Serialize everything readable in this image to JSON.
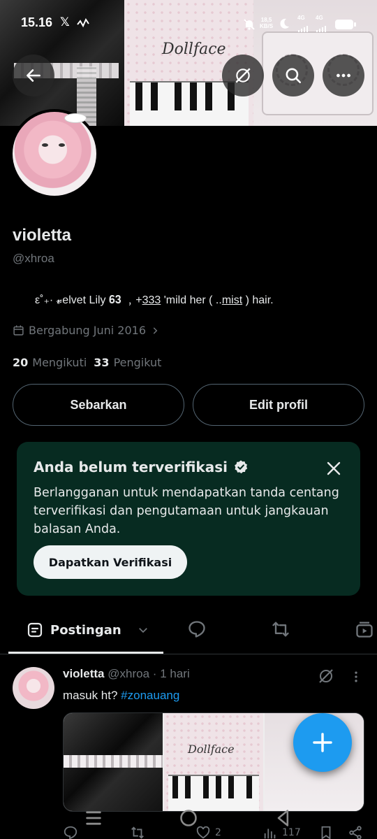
{
  "status_bar": {
    "time": "15.16",
    "speed_value": "18,5",
    "speed_unit": "KB/S",
    "net1": "4G",
    "net2": "4G"
  },
  "banner": {
    "logo_text": "Dollface"
  },
  "profile": {
    "name": "violetta",
    "handle": "@xhroa",
    "bio_prefix": "ε˚₊· 𝓿elvet Lily 𝟔𝟑 ﹐+",
    "bio_underline_1": "333",
    "bio_middle": " 'mild her ( ..",
    "bio_underline_2": "mist",
    "bio_suffix": " ) hair.",
    "joined": "Bergabung Juni 2016",
    "following_count": "20",
    "following_label": "Mengikuti",
    "followers_count": "33",
    "followers_label": "Pengikut",
    "share_button": "Sebarkan",
    "edit_button": "Edit profil"
  },
  "verify_card": {
    "title": "Anda belum terverifikasi",
    "description": "Berlangganan untuk mendapatkan tanda centang terverifikasi dan pengutamaan untuk jangkauan balasan Anda.",
    "button": "Dapatkan Verifikasi",
    "bg_color": "#072b21",
    "check_color": "#e7e9ea"
  },
  "tabs": {
    "active_label": "Postingan",
    "icons": [
      "posts-icon",
      "replies-icon",
      "reposts-icon",
      "media-icon"
    ]
  },
  "post": {
    "name": "violetta",
    "handle": "@xhroa",
    "sep": "·",
    "time": "1 hari",
    "text": "masuk ht?",
    "hashtag": "#zonauang",
    "media_logo": "Dollface",
    "likes": "2",
    "views": "117"
  },
  "colors": {
    "accent": "#1d9bf0",
    "background": "#000000",
    "secondary_text": "#71767b",
    "primary_text": "#e7e9ea"
  }
}
